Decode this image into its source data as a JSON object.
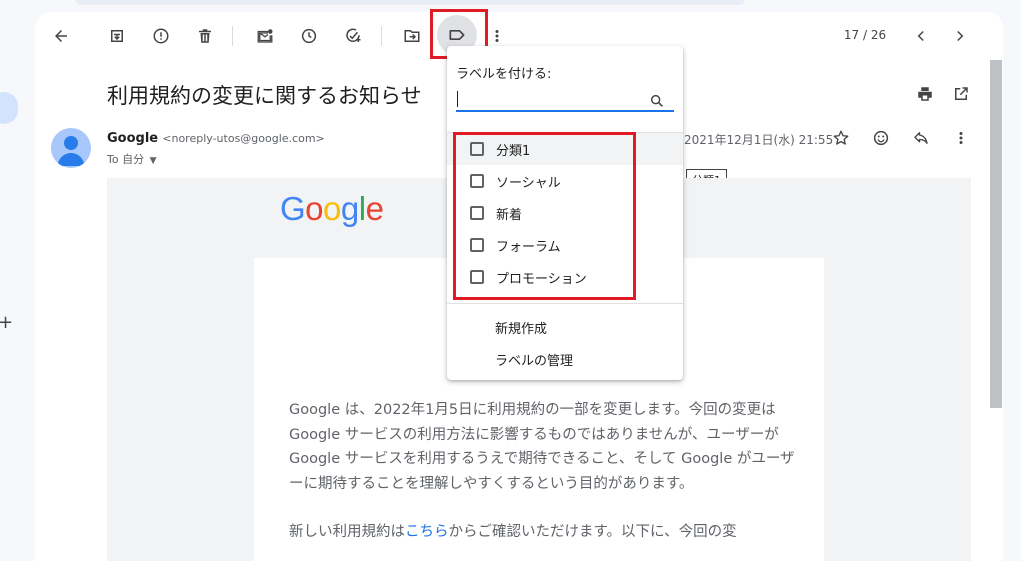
{
  "toolbar": {
    "back": "arrow-back-icon",
    "archive": "archive-icon",
    "report_spam": "report-spam-icon",
    "delete": "delete-icon",
    "mark_unread": "mark-unread-icon",
    "snooze": "snooze-icon",
    "add_task": "add-task-icon",
    "move_to": "move-to-icon",
    "labels": "label-icon",
    "more": "more-vert-icon",
    "pager": "17 / 26"
  },
  "email": {
    "subject": "利用規約の変更に関するお知らせ",
    "sender_name": "Google",
    "sender_email": "<noreply-utos@google.com>",
    "to": "To 自分",
    "date": "2021年12月1日(水) 21:55",
    "tooltip": "分類1",
    "logo": "Google",
    "body_p1": "Google は、2022年1月5日に利用規約の一部を変更します。今回の変更は Google サービスの利用方法に影響するものではありませんが、ユーザーが Google サービスを利用するうえで期待できること、そして Google がユーザーに期待することを理解しやすくするという目的があります。",
    "body_p2_a": "新しい利用規約は",
    "body_p2_link": "こちら",
    "body_p2_b": "からご確認いただけます。以下に、今回の変"
  },
  "label_menu": {
    "heading": "ラベルを付ける:",
    "search_value": "",
    "items": [
      {
        "label": "分類1"
      },
      {
        "label": "ソーシャル"
      },
      {
        "label": "新着"
      },
      {
        "label": "フォーラム"
      },
      {
        "label": "プロモーション"
      }
    ],
    "create_new": "新規作成",
    "manage": "ラベルの管理"
  },
  "colors": {
    "highlight": "#e01b24",
    "accent": "#1a73e8"
  }
}
